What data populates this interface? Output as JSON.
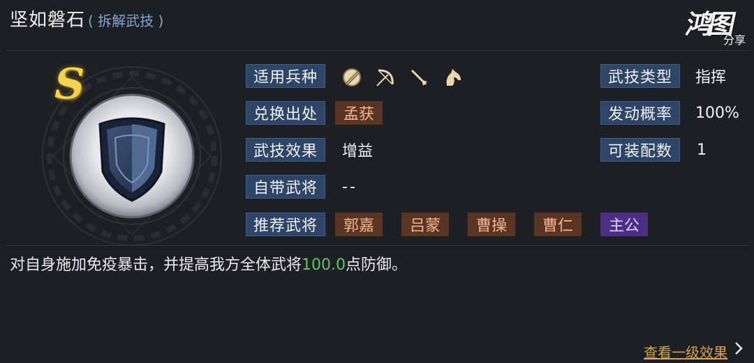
{
  "header": {
    "skill_name": "坚如磐石",
    "skill_subtitle": "( 拆解武技 )"
  },
  "watermark": {
    "main": "鸿图",
    "sub": "分享"
  },
  "grade": "S",
  "rows": {
    "troop_label": "适用兵种",
    "troop_icons": [
      "shield-icon",
      "bow-icon",
      "spear-icon",
      "horse-icon"
    ],
    "source_label": "兑换出处",
    "source_value": "孟获",
    "effect_label": "武技效果",
    "effect_value": "增益",
    "own_general_label": "自带武将",
    "own_general_value": "--",
    "recommend_label": "推荐武将",
    "recommend_generals": [
      "郭嘉",
      "吕蒙",
      "曹操",
      "曹仁",
      "主公"
    ],
    "type_label": "武技类型",
    "type_value": "指挥",
    "rate_label": "发动概率",
    "rate_value": "100%",
    "equip_label": "可装配数",
    "equip_value": "1"
  },
  "description": {
    "prefix": "对自身施加免疫暴击，并提高我方全体武将",
    "highlight": "100.0",
    "suffix": "点防御。"
  },
  "footer": {
    "more_label": "查看一级效果"
  },
  "colors": {
    "background": "#1e1f22",
    "label_bg": "#2d4566",
    "tag_bg": "#5a3524",
    "tag_text": "#f3b58c",
    "lord_tag_bg": "#4a2f84",
    "highlight": "#5fc36a",
    "link": "#d6a24e",
    "grade": "#f3d24d"
  }
}
